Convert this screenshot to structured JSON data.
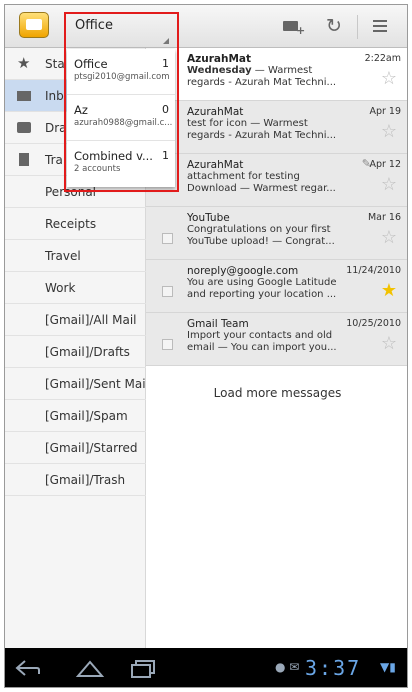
{
  "actionbar": {
    "account": "Office",
    "compose_icon": "compose-mail-icon",
    "refresh_icon": "refresh-icon",
    "menu_icon": "menu-icon"
  },
  "account_menu": [
    {
      "name": "Office",
      "count": "1",
      "sub": "ptsgi2010@gmail.com"
    },
    {
      "name": "Az",
      "count": "0",
      "sub": "azurah0988@gmail.c..."
    },
    {
      "name": "Combined v...",
      "count": "1",
      "sub": "2 accounts"
    }
  ],
  "folders": [
    {
      "label": "Sta",
      "icon": "star-icon"
    },
    {
      "label": "Inb",
      "icon": "inbox-icon"
    },
    {
      "label": "Dra",
      "icon": "drafts-icon"
    },
    {
      "label": "Tra",
      "icon": "trash-icon"
    },
    {
      "label": "Personal"
    },
    {
      "label": "Receipts"
    },
    {
      "label": "Travel"
    },
    {
      "label": "Work"
    },
    {
      "label": "[Gmail]/All Mail"
    },
    {
      "label": "[Gmail]/Drafts"
    },
    {
      "label": "[Gmail]/Sent Mail"
    },
    {
      "label": "[Gmail]/Spam"
    },
    {
      "label": "[Gmail]/Starred"
    },
    {
      "label": "[Gmail]/Trash"
    }
  ],
  "messages": [
    {
      "sender": "AzurahMat",
      "date": "2:22am",
      "subject": "Wednesday",
      "line1_rest": " — Warmest",
      "line2": "regards - Azurah Mat Techni...",
      "unread": true,
      "starred": false
    },
    {
      "sender": "AzurahMat",
      "date": "Apr 19",
      "line1": "test for icon — Warmest",
      "line2": "regards - Azurah Mat Techni...",
      "unread": false,
      "starred": false
    },
    {
      "sender": "AzurahMat",
      "date": "Apr 12",
      "line1": "attachment for testing",
      "line2": "Download — Warmest regar...",
      "unread": false,
      "starred": false,
      "attachment": true
    },
    {
      "sender": "YouTube",
      "date": "Mar 16",
      "line1": "Congratulations on your first",
      "line2": "YouTube upload! — Congrat...",
      "unread": false,
      "starred": false
    },
    {
      "sender": "noreply@google.com",
      "date": "11/24/2010",
      "line1": "You are using Google Latitude",
      "line2": "and reporting your location ...",
      "unread": false,
      "starred": true
    },
    {
      "sender": "Gmail Team",
      "date": "10/25/2010",
      "line1": "Import your contacts and old",
      "line2": "email — You can import you...",
      "unread": false,
      "starred": false
    }
  ],
  "load_more": "Load more messages",
  "status": {
    "clock": "3:37"
  }
}
